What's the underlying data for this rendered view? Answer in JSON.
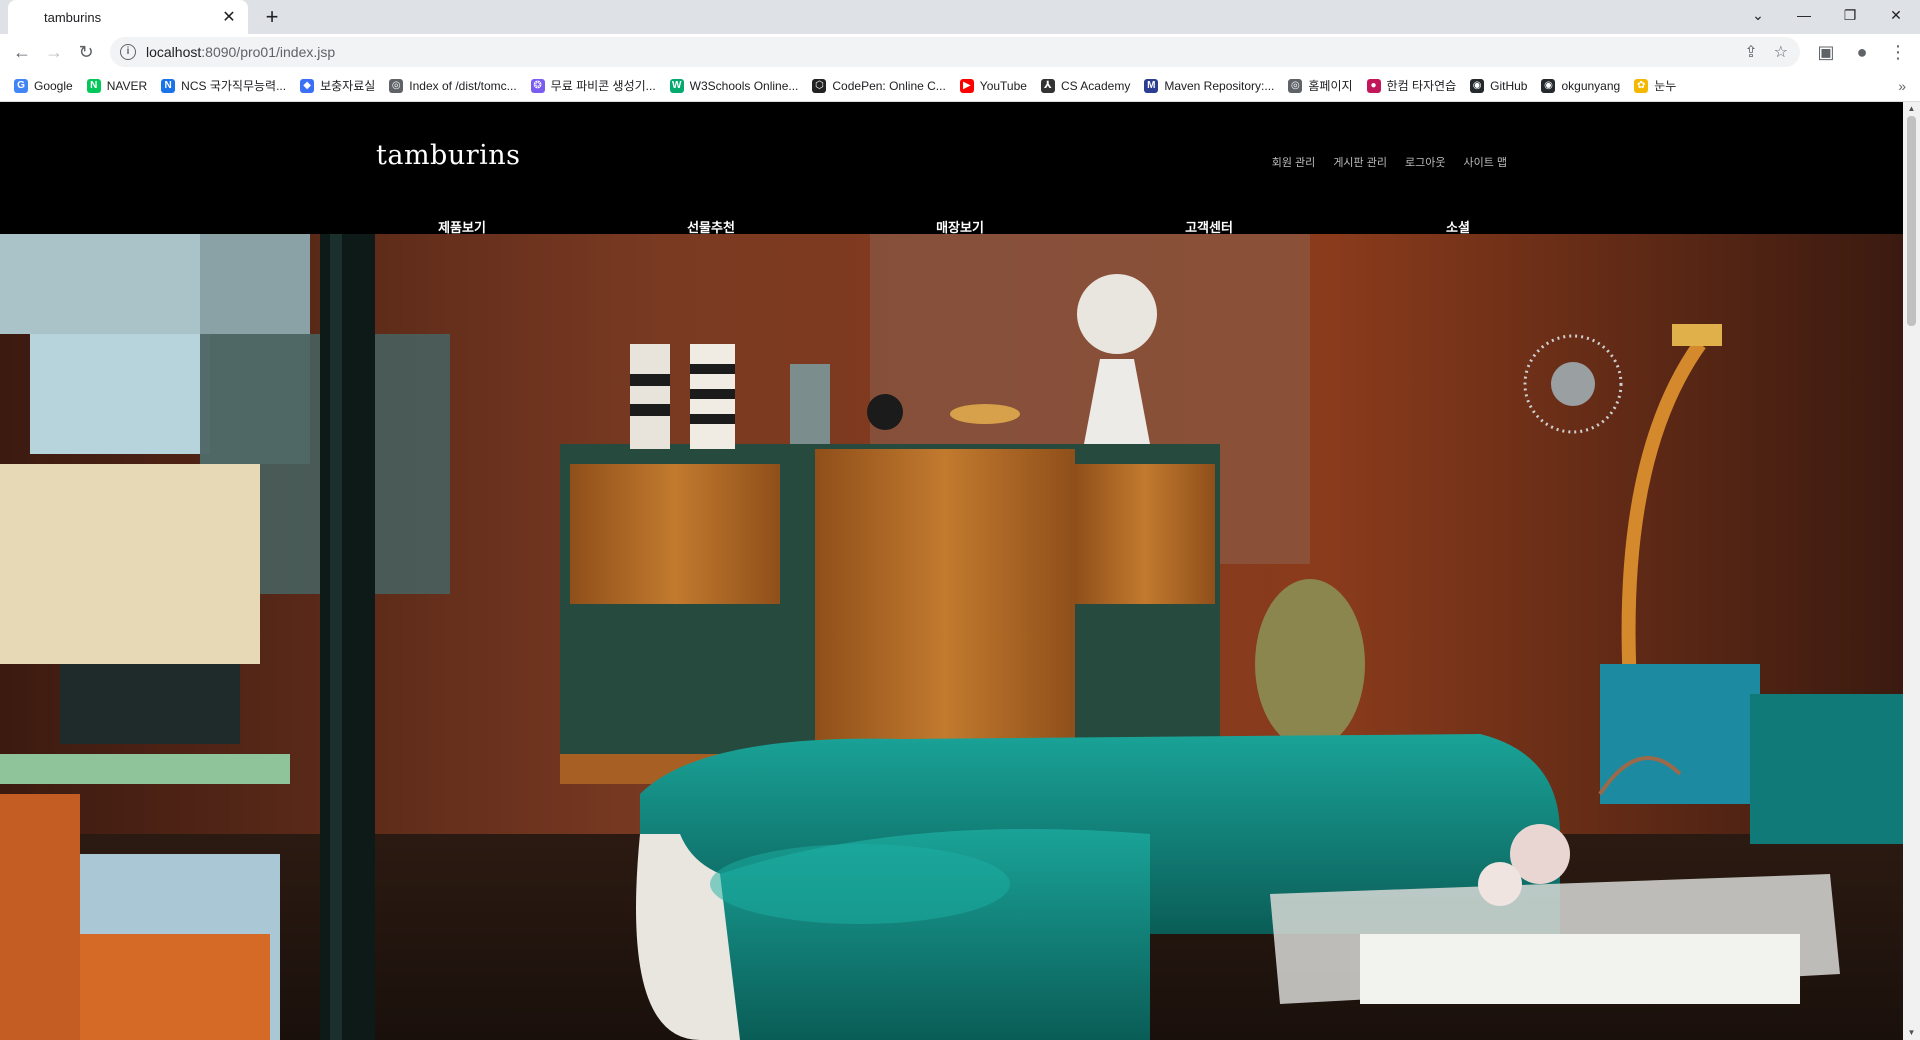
{
  "browser": {
    "tab_title": "tamburins",
    "close_glyph": "✕",
    "new_tab_glyph": "+",
    "url_host": "localhost",
    "url_rest": ":8090/pro01/index.jsp",
    "window_controls": [
      "⌄",
      "—",
      "❐",
      "✕"
    ]
  },
  "bookmarks": [
    {
      "label": "Google",
      "icon": "google-icon",
      "color": "#4285f4",
      "glyph": "G"
    },
    {
      "label": "NAVER",
      "icon": "naver-icon",
      "color": "#03c75a",
      "glyph": "N"
    },
    {
      "label": "NCS 국가직무능력...",
      "icon": "ncs-icon",
      "color": "#1a73e8",
      "glyph": "N"
    },
    {
      "label": "보충자료실",
      "icon": "shield-icon",
      "color": "#3b6ff5",
      "glyph": "◆"
    },
    {
      "label": "Index of /dist/tomc...",
      "icon": "globe-icon",
      "color": "#5f6368",
      "glyph": "◎"
    },
    {
      "label": "무료 파비콘 생성기...",
      "icon": "favicon-gen-icon",
      "color": "#7b5cf0",
      "glyph": "❂"
    },
    {
      "label": "W3Schools Online...",
      "icon": "w3schools-icon",
      "color": "#04aa6d",
      "glyph": "W"
    },
    {
      "label": "CodePen: Online C...",
      "icon": "codepen-icon",
      "color": "#222222",
      "glyph": "⬡"
    },
    {
      "label": "YouTube",
      "icon": "youtube-icon",
      "color": "#ff0000",
      "glyph": "▶"
    },
    {
      "label": "CS Academy",
      "icon": "cs-academy-icon",
      "color": "#333333",
      "glyph": "⅄"
    },
    {
      "label": "Maven Repository:...",
      "icon": "maven-icon",
      "color": "#2c3e91",
      "glyph": "M"
    },
    {
      "label": "홈페이지",
      "icon": "globe-icon",
      "color": "#5f6368",
      "glyph": "◎"
    },
    {
      "label": "한컴 타자연습",
      "icon": "hancom-icon",
      "color": "#c2185b",
      "glyph": "●"
    },
    {
      "label": "GitHub",
      "icon": "github-icon",
      "color": "#24292e",
      "glyph": "◉"
    },
    {
      "label": "okgunyang",
      "icon": "github-icon",
      "color": "#24292e",
      "glyph": "◉"
    },
    {
      "label": "눈누",
      "icon": "noonnu-icon",
      "color": "#f5b800",
      "glyph": "✿"
    }
  ],
  "bookmarks_more": "»",
  "site": {
    "logo": "tamburins",
    "util_nav": [
      "회원 관리",
      "게시판 관리",
      "로그아웃",
      "사이트 맵"
    ],
    "gnb": [
      "제품보기",
      "선물추천",
      "매장보기",
      "고객센터",
      "소셜"
    ]
  },
  "colors": {
    "header_bg": "#000000",
    "hero_wall": "#6b2f18",
    "sofa": "#0f8a80",
    "wood": "#b26a25"
  }
}
